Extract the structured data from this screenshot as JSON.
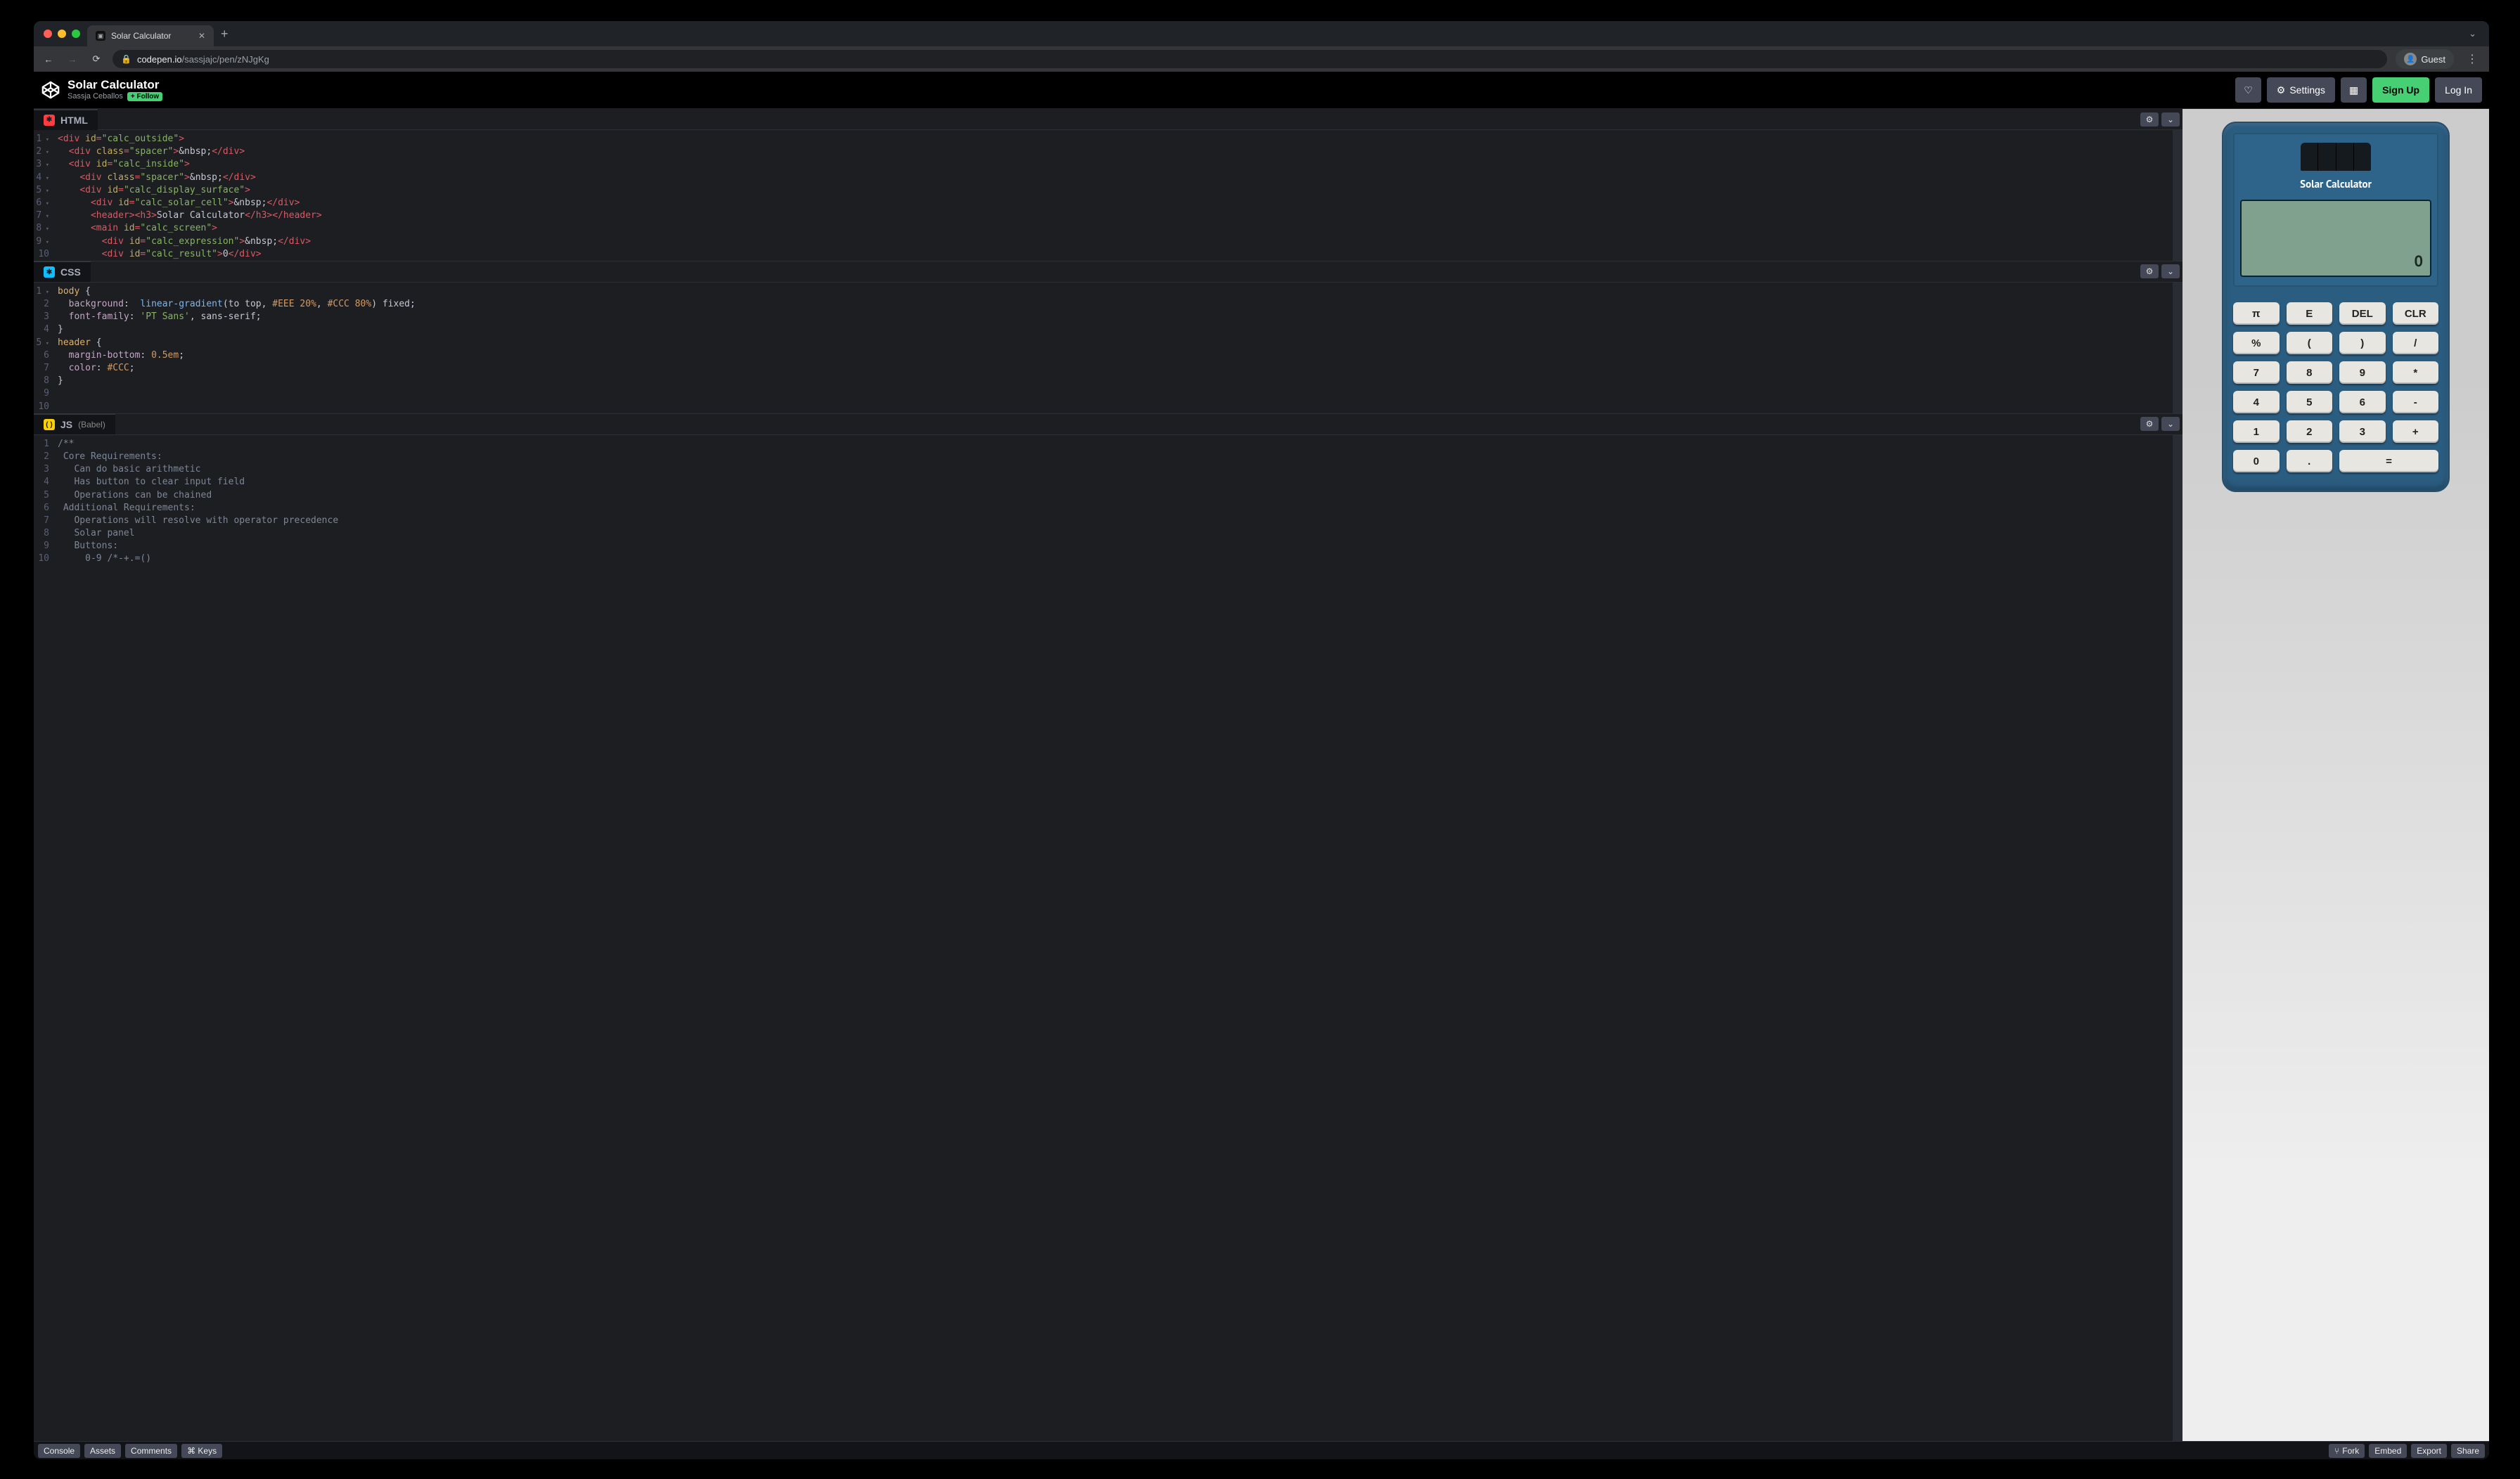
{
  "browser": {
    "tab_title": "Solar Calculator",
    "url_host": "codepen.io",
    "url_path": "/sassjajc/pen/zNJgKg",
    "guest_label": "Guest"
  },
  "header": {
    "title": "Solar Calculator",
    "author": "Sassja Ceballos",
    "follow_label": "+ Follow",
    "settings_label": "Settings",
    "signup_label": "Sign Up",
    "login_label": "Log In"
  },
  "panels": {
    "html_label": "HTML",
    "css_label": "CSS",
    "js_label": "JS",
    "js_sub": "(Babel)"
  },
  "html_lines": [
    {
      "n": "1",
      "fold": true,
      "seg": [
        [
          "t-tag",
          "<div "
        ],
        [
          "t-attr",
          "id"
        ],
        [
          "t-tag",
          "="
        ],
        [
          "t-str",
          "\"calc_outside\""
        ],
        [
          "t-tag",
          ">"
        ]
      ]
    },
    {
      "n": "2",
      "fold": true,
      "seg": [
        [
          "t-plain",
          "  "
        ],
        [
          "t-tag",
          "<div "
        ],
        [
          "t-attr",
          "class"
        ],
        [
          "t-tag",
          "="
        ],
        [
          "t-str",
          "\"spacer\""
        ],
        [
          "t-tag",
          ">"
        ],
        [
          "t-plain",
          "&nbsp;"
        ],
        [
          "t-tag",
          "</div>"
        ]
      ]
    },
    {
      "n": "3",
      "fold": true,
      "seg": [
        [
          "t-plain",
          "  "
        ],
        [
          "t-tag",
          "<div "
        ],
        [
          "t-attr",
          "id"
        ],
        [
          "t-tag",
          "="
        ],
        [
          "t-str",
          "\"calc_inside\""
        ],
        [
          "t-tag",
          ">"
        ]
      ]
    },
    {
      "n": "4",
      "fold": true,
      "seg": [
        [
          "t-plain",
          "    "
        ],
        [
          "t-tag",
          "<div "
        ],
        [
          "t-attr",
          "class"
        ],
        [
          "t-tag",
          "="
        ],
        [
          "t-str",
          "\"spacer\""
        ],
        [
          "t-tag",
          ">"
        ],
        [
          "t-plain",
          "&nbsp;"
        ],
        [
          "t-tag",
          "</div>"
        ]
      ]
    },
    {
      "n": "5",
      "fold": true,
      "seg": [
        [
          "t-plain",
          "    "
        ],
        [
          "t-tag",
          "<div "
        ],
        [
          "t-attr",
          "id"
        ],
        [
          "t-tag",
          "="
        ],
        [
          "t-str",
          "\"calc_display_surface\""
        ],
        [
          "t-tag",
          ">"
        ]
      ]
    },
    {
      "n": "6",
      "fold": true,
      "seg": [
        [
          "t-plain",
          "      "
        ],
        [
          "t-tag",
          "<div "
        ],
        [
          "t-attr",
          "id"
        ],
        [
          "t-tag",
          "="
        ],
        [
          "t-str",
          "\"calc_solar_cell\""
        ],
        [
          "t-tag",
          ">"
        ],
        [
          "t-plain",
          "&nbsp;"
        ],
        [
          "t-tag",
          "</div>"
        ]
      ]
    },
    {
      "n": "7",
      "fold": true,
      "seg": [
        [
          "t-plain",
          "      "
        ],
        [
          "t-tag",
          "<header><h3>"
        ],
        [
          "t-plain",
          "Solar Calculator"
        ],
        [
          "t-tag",
          "</h3></header>"
        ]
      ]
    },
    {
      "n": "8",
      "fold": true,
      "seg": [
        [
          "t-plain",
          "      "
        ],
        [
          "t-tag",
          "<main "
        ],
        [
          "t-attr",
          "id"
        ],
        [
          "t-tag",
          "="
        ],
        [
          "t-str",
          "\"calc_screen\""
        ],
        [
          "t-tag",
          ">"
        ]
      ]
    },
    {
      "n": "9",
      "fold": true,
      "seg": [
        [
          "t-plain",
          "        "
        ],
        [
          "t-tag",
          "<div "
        ],
        [
          "t-attr",
          "id"
        ],
        [
          "t-tag",
          "="
        ],
        [
          "t-str",
          "\"calc_expression\""
        ],
        [
          "t-tag",
          ">"
        ],
        [
          "t-plain",
          "&nbsp;"
        ],
        [
          "t-tag",
          "</div>"
        ]
      ]
    },
    {
      "n": "10",
      "fold": true,
      "seg": [
        [
          "t-plain",
          "        "
        ],
        [
          "t-tag",
          "<div "
        ],
        [
          "t-attr",
          "id"
        ],
        [
          "t-tag",
          "="
        ],
        [
          "t-str",
          "\"calc_result\""
        ],
        [
          "t-tag",
          ">"
        ],
        [
          "t-plain",
          "0"
        ],
        [
          "t-tag",
          "</div>"
        ]
      ]
    }
  ],
  "css_lines": [
    {
      "n": "1",
      "fold": true,
      "seg": [
        [
          "t-id",
          "body "
        ],
        [
          "t-punct",
          "{"
        ]
      ]
    },
    {
      "n": "2",
      "seg": [
        [
          "t-plain",
          "  "
        ],
        [
          "t-key",
          "background"
        ],
        [
          "t-punct",
          ":  "
        ],
        [
          "t-func",
          "linear-gradient"
        ],
        [
          "t-punct",
          "("
        ],
        [
          "t-plain",
          "to top"
        ],
        [
          "t-punct",
          ", "
        ],
        [
          "t-num",
          "#EEE "
        ],
        [
          "t-num",
          "20%"
        ],
        [
          "t-punct",
          ", "
        ],
        [
          "t-num",
          "#CCC "
        ],
        [
          "t-num",
          "80%"
        ],
        [
          "t-punct",
          ") "
        ],
        [
          "t-plain",
          "fixed"
        ],
        [
          "t-punct",
          ";"
        ]
      ]
    },
    {
      "n": "3",
      "seg": [
        [
          "t-plain",
          "  "
        ],
        [
          "t-key",
          "font-family"
        ],
        [
          "t-punct",
          ": "
        ],
        [
          "t-str",
          "'PT Sans'"
        ],
        [
          "t-punct",
          ", "
        ],
        [
          "t-plain",
          "sans-serif"
        ],
        [
          "t-punct",
          ";"
        ]
      ]
    },
    {
      "n": "4",
      "seg": [
        [
          "t-punct",
          "}"
        ]
      ]
    },
    {
      "n": "5",
      "fold": true,
      "seg": [
        [
          "t-id",
          "header "
        ],
        [
          "t-punct",
          "{"
        ]
      ]
    },
    {
      "n": "6",
      "seg": [
        [
          "t-plain",
          "  "
        ],
        [
          "t-key",
          "margin-bottom"
        ],
        [
          "t-punct",
          ": "
        ],
        [
          "t-num",
          "0.5em"
        ],
        [
          "t-punct",
          ";"
        ]
      ]
    },
    {
      "n": "7",
      "seg": [
        [
          "t-plain",
          "  "
        ],
        [
          "t-key",
          "color"
        ],
        [
          "t-punct",
          ": "
        ],
        [
          "t-num",
          "#CCC"
        ],
        [
          "t-punct",
          ";"
        ]
      ]
    },
    {
      "n": "8",
      "seg": [
        [
          "t-punct",
          "}"
        ]
      ]
    },
    {
      "n": "9",
      "seg": [
        [
          "t-plain",
          " "
        ]
      ]
    },
    {
      "n": "10",
      "seg": [
        [
          "t-plain",
          " "
        ]
      ]
    }
  ],
  "js_lines": [
    {
      "n": "1",
      "seg": [
        [
          "t-comment",
          "/**"
        ]
      ]
    },
    {
      "n": "2",
      "seg": [
        [
          "t-comment",
          " Core Requirements:"
        ]
      ]
    },
    {
      "n": "3",
      "seg": [
        [
          "t-comment",
          "   Can do basic arithmetic"
        ]
      ]
    },
    {
      "n": "4",
      "seg": [
        [
          "t-comment",
          "   Has button to clear input field"
        ]
      ]
    },
    {
      "n": "5",
      "seg": [
        [
          "t-comment",
          "   Operations can be chained"
        ]
      ]
    },
    {
      "n": "6",
      "seg": [
        [
          "t-comment",
          " Additional Requirements:"
        ]
      ]
    },
    {
      "n": "7",
      "seg": [
        [
          "t-comment",
          "   Operations will resolve with operator precedence"
        ]
      ]
    },
    {
      "n": "8",
      "seg": [
        [
          "t-comment",
          "   Solar panel"
        ]
      ]
    },
    {
      "n": "9",
      "seg": [
        [
          "t-comment",
          "   Buttons:"
        ]
      ]
    },
    {
      "n": "10",
      "seg": [
        [
          "t-comment",
          "     0-9 /*-+.=()"
        ]
      ]
    }
  ],
  "calc": {
    "title": "Solar Calculator",
    "expression": "",
    "result": "0",
    "keys": [
      {
        "l": "π"
      },
      {
        "l": "E"
      },
      {
        "l": "DEL"
      },
      {
        "l": "CLR"
      },
      {
        "l": "%"
      },
      {
        "l": "("
      },
      {
        "l": ")"
      },
      {
        "l": "/"
      },
      {
        "l": "7"
      },
      {
        "l": "8"
      },
      {
        "l": "9"
      },
      {
        "l": "*"
      },
      {
        "l": "4"
      },
      {
        "l": "5"
      },
      {
        "l": "6"
      },
      {
        "l": "-"
      },
      {
        "l": "1"
      },
      {
        "l": "2"
      },
      {
        "l": "3"
      },
      {
        "l": "+"
      },
      {
        "l": "0"
      },
      {
        "l": "."
      },
      {
        "l": "=",
        "wide": true
      }
    ]
  },
  "footer": {
    "console": "Console",
    "assets": "Assets",
    "comments": "Comments",
    "keys": "⌘ Keys",
    "fork": "Fork",
    "embed": "Embed",
    "export": "Export",
    "share": "Share"
  }
}
